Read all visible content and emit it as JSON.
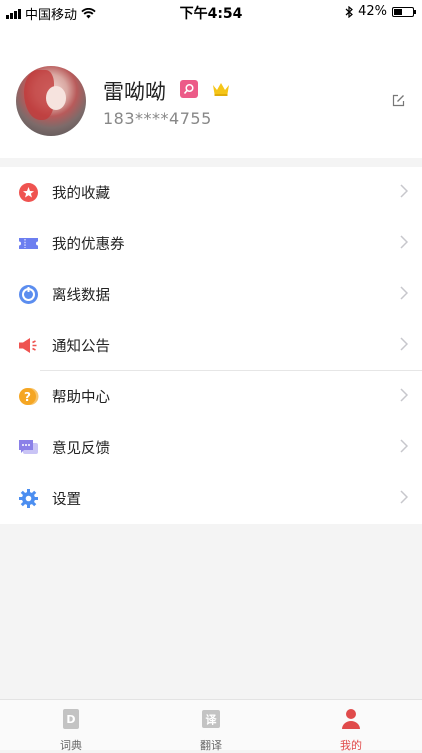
{
  "status_bar": {
    "carrier": "中国移动",
    "time": "下午4:54",
    "battery": "42%",
    "battery_level": 0.42
  },
  "profile": {
    "name": "雷呦呦",
    "phone": "183****4755"
  },
  "menu": {
    "items": [
      {
        "label": "我的收藏",
        "icon": "star-icon",
        "color": "#ef5350"
      },
      {
        "label": "我的优惠券",
        "icon": "coupon-icon",
        "color": "#6c7ef0"
      },
      {
        "label": "离线数据",
        "icon": "offline-data-icon",
        "color": "#5b8def"
      },
      {
        "label": "通知公告",
        "icon": "megaphone-icon",
        "color": "#ef5350"
      },
      {
        "label": "帮助中心",
        "icon": "help-icon",
        "color": "#f5a623"
      },
      {
        "label": "意见反馈",
        "icon": "feedback-icon",
        "color": "#8a80e8"
      },
      {
        "label": "设置",
        "icon": "gear-icon",
        "color": "#4c8ef0"
      }
    ]
  },
  "tabbar": {
    "tabs": [
      {
        "label": "词典",
        "icon": "dictionary-icon",
        "active": false
      },
      {
        "label": "翻译",
        "icon": "translate-icon",
        "active": false
      },
      {
        "label": "我的",
        "icon": "profile-icon",
        "active": true
      }
    ]
  },
  "colors": {
    "accent": "#e04b4b",
    "background": "#f4f4f4"
  }
}
